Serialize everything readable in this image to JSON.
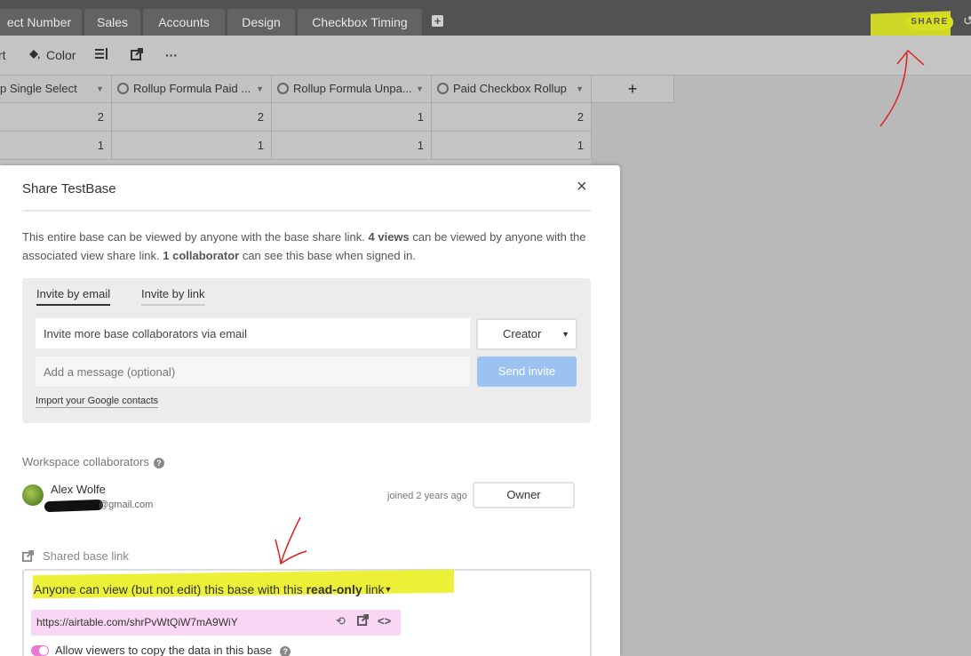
{
  "tabs": [
    "ect Number",
    "Sales",
    "Accounts",
    "Design",
    "Checkbox Timing"
  ],
  "tab_add_icon": "plus-square-icon",
  "share_label": "SHARE",
  "toolbar": {
    "sort_label": "rt",
    "color_label": "Color",
    "row_height_icon": "row-height-icon",
    "share_view_icon": "external-link-icon",
    "more_label": "···"
  },
  "grid": {
    "columns": [
      "p Single Select",
      "Rollup Formula Paid ...",
      "Rollup Formula Unpa...",
      "Paid Checkbox Rollup"
    ],
    "add_column": "+",
    "rows": [
      [
        "2",
        "2",
        "1",
        "2"
      ],
      [
        "1",
        "1",
        "1",
        "1"
      ]
    ]
  },
  "modal": {
    "title": "Share TestBase",
    "close": "×",
    "desc_1": "This entire base can be viewed by anyone with the base share link. ",
    "desc_views": "4 views",
    "desc_2": " can be viewed by anyone with the associated view share link. ",
    "desc_collab": "1 collaborator",
    "desc_3": " can see this base when signed in.",
    "invite": {
      "tab_email": "Invite by email",
      "tab_link": "Invite by link",
      "email_value": "Invite more base collaborators via email",
      "role": "Creator",
      "message_placeholder": "Add a message (optional)",
      "send": "Send invite",
      "import": "Import your Google contacts"
    },
    "workspace": {
      "label": "Workspace collaborators",
      "user_name": "Alex Wolfe",
      "user_email": "@gmail.com",
      "joined": "joined 2 years ago",
      "role": "Owner"
    },
    "shared_link": {
      "label": "Shared base link",
      "access_1": "Anyone can view (but not edit) this base with this ",
      "access_bold": "read-only",
      "access_2": " link",
      "url": "https://airtable.com/shrPvWtQiW7mA9WiY",
      "allow_copy": "Allow viewers to copy the data in this base"
    }
  },
  "colors": {
    "highlight": "#ecf036",
    "annotation_red": "#e02020",
    "url_bg": "#f9d7f4",
    "toggle_on": "#e879d4",
    "send_button": "#9cc2f2"
  }
}
